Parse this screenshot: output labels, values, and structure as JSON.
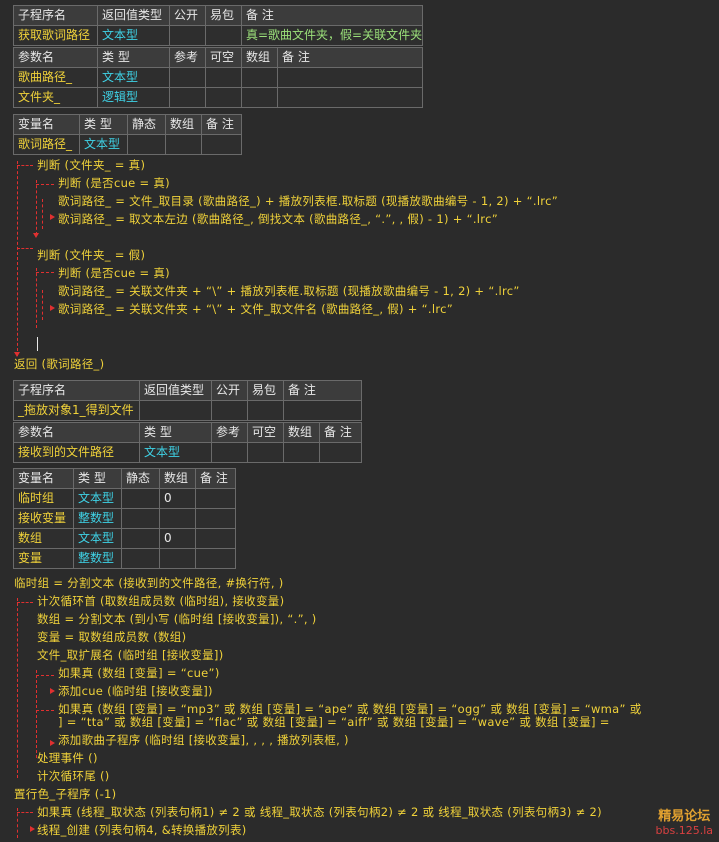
{
  "sub1": {
    "header": [
      "子程序名",
      "返回值类型",
      "公开",
      "易包",
      "备 注"
    ],
    "row": [
      "获取歌词路径",
      "文本型",
      "",
      "",
      "真=歌曲文件夹，假=关联文件夹"
    ],
    "param_header": [
      "参数名",
      "类 型",
      "参考",
      "可空",
      "数组",
      "备 注"
    ],
    "params": [
      [
        "歌曲路径_",
        "文本型"
      ],
      [
        "文件夹_",
        "逻辑型"
      ]
    ],
    "var_header": [
      "变量名",
      "类 型",
      "静态",
      "数组",
      "备 注"
    ],
    "vars": [
      [
        "歌词路径_",
        "文本型"
      ]
    ]
  },
  "code1": [
    "判断 (文件夹_ = 真)",
    "判断 (是否cue = 真)",
    "歌词路径_ = 文件_取目录 (歌曲路径_) + 播放列表框.取标题 (现播放歌曲编号 - 1, 2) + “.lrc”",
    "歌词路径_ = 取文本左边 (歌曲路径_, 倒找文本 (歌曲路径_, “.”, , 假) - 1) + “.lrc”",
    "判断 (文件夹_ = 假)",
    "判断 (是否cue = 真)",
    "歌词路径_ = 关联文件夹 + “\\” + 播放列表框.取标题 (现播放歌曲编号 - 1, 2) + “.lrc”",
    "歌词路径_ = 关联文件夹 + “\\” + 文件_取文件名 (歌曲路径_, 假) + “.lrc”",
    "返回 (歌词路径_)"
  ],
  "sub2": {
    "header": [
      "子程序名",
      "返回值类型",
      "公开",
      "易包",
      "备 注"
    ],
    "row": [
      "_拖放对象1_得到文件",
      "",
      "",
      "",
      ""
    ],
    "param_header": [
      "参数名",
      "类 型",
      "参考",
      "可空",
      "数组",
      "备 注"
    ],
    "params": [
      [
        "接收到的文件路径",
        "文本型"
      ]
    ],
    "var_header": [
      "变量名",
      "类 型",
      "静态",
      "数组",
      "备 注"
    ],
    "vars": [
      [
        "临时组",
        "文本型",
        "0"
      ],
      [
        "接收变量",
        "整数型",
        ""
      ],
      [
        "数组",
        "文本型",
        "0"
      ],
      [
        "变量",
        "整数型",
        ""
      ]
    ]
  },
  "code2": [
    "临时组 = 分割文本 (接收到的文件路径, #换行符, )",
    "计次循环首 (取数组成员数 (临时组), 接收变量)",
    "数组 = 分割文本 (到小写 (临时组 [接收变量]), “.”, )",
    "变量 = 取数组成员数 (数组)",
    "文件_取扩展名 (临时组 [接收变量])",
    "如果真 (数组 [变量] = “cue”)",
    "添加cue (临时组 [接收变量])",
    "如果真 (数组 [变量] = “mp3” 或 数组 [变量] = “ape” 或 数组 [变量] = “ogg” 或 数组 [变量] = “wma” 或",
    "] = “tta” 或 数组 [变量] = “flac” 或 数组 [变量] = “aiff” 或 数组 [变量] = “wave” 或 数组 [变量] =",
    "添加歌曲子程序 (临时组 [接收变量], , , , 播放列表框, )",
    "处理事件 ()",
    "计次循环尾 ()",
    "置行色_子程序 (-1)",
    "如果真 (线程_取状态 (列表句柄1) ≠ 2 或 线程_取状态 (列表句柄2) ≠ 2 或 线程_取状态 (列表句柄3) ≠ 2)",
    "线程_创建 (列表句柄4, &转换播放列表)"
  ],
  "watermark": {
    "line1": "精易论坛",
    "line2": "bbs.125.la"
  },
  "colors": {
    "background": "#2b2b2b",
    "type_text": "#3fd2e6",
    "name_text": "#f0d23a",
    "flow_line": "#e03030"
  }
}
